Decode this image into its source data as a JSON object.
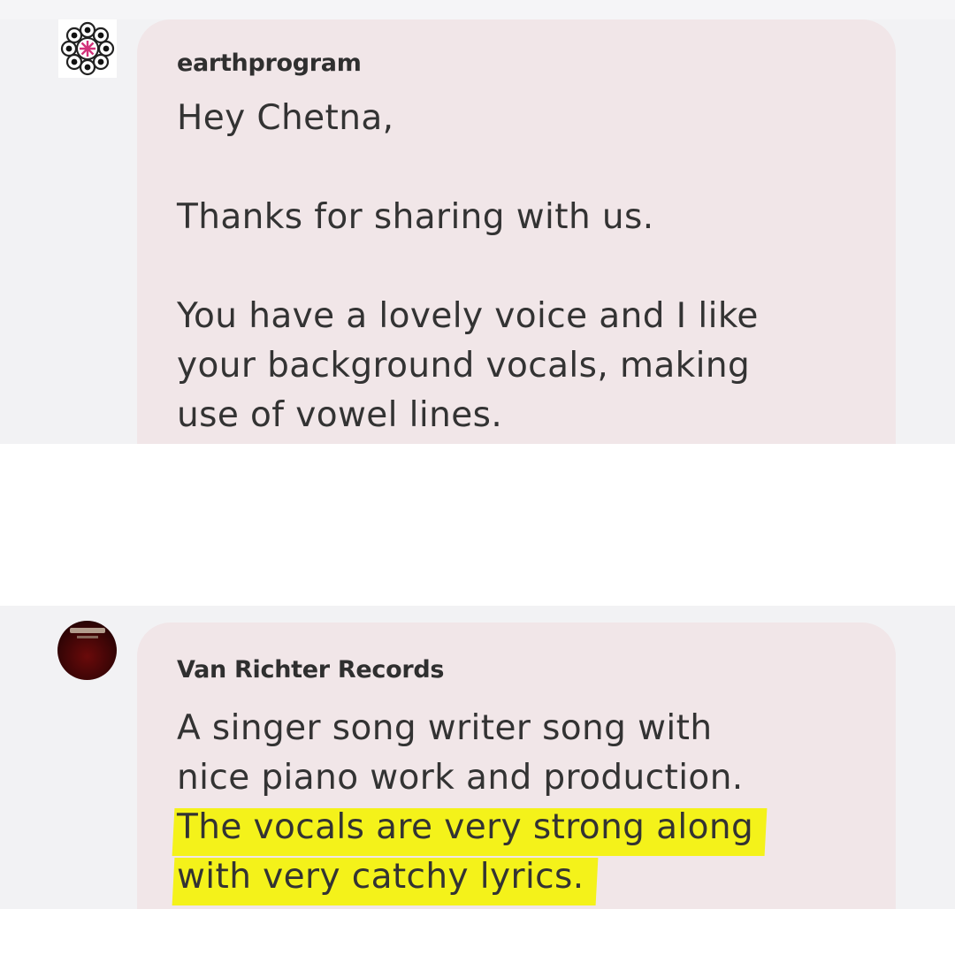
{
  "comments": [
    {
      "author": "earthprogram",
      "avatar_icon": "mandala-flower-icon",
      "lines": [
        {
          "text": "Hey Chetna,",
          "highlight": false
        },
        {
          "text": "",
          "highlight": false
        },
        {
          "text": "Thanks for sharing with us.",
          "highlight": false
        },
        {
          "text": "",
          "highlight": false
        },
        {
          "text": "You have a lovely voice and I like",
          "highlight": false
        },
        {
          "text": "your background vocals, making",
          "highlight": false
        },
        {
          "text": "use of vowel lines.",
          "highlight": false
        }
      ]
    },
    {
      "author": "Van Richter Records",
      "avatar_icon": "record-label-cover-icon",
      "lines": [
        {
          "text": "A singer song writer song with",
          "highlight": false
        },
        {
          "text": "nice piano work and production.",
          "highlight": false
        },
        {
          "text": "The vocals are very strong along",
          "highlight": true
        },
        {
          "text": "with very catchy lyrics.",
          "highlight": true
        }
      ]
    }
  ],
  "colors": {
    "panel_bg": "#f2f2f4",
    "bubble_bg": "#f1e6e8",
    "highlight": "#f4f21a",
    "text": "#333333"
  }
}
